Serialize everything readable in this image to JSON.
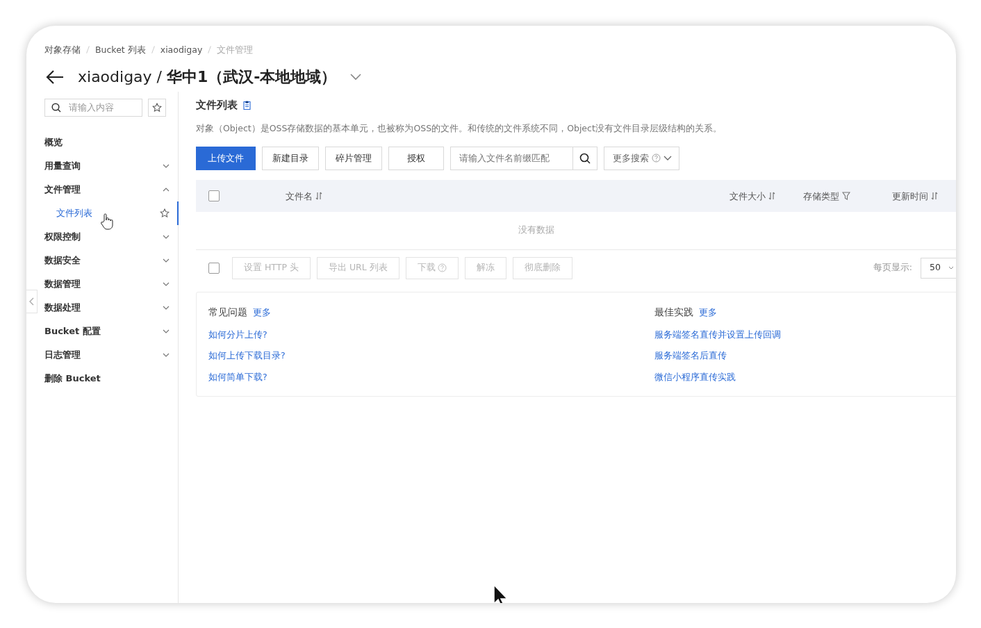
{
  "breadcrumb": [
    {
      "label": "对象存储",
      "current": false
    },
    {
      "label": "Bucket 列表",
      "current": false
    },
    {
      "label": "xiaodigay",
      "current": false
    },
    {
      "label": "文件管理",
      "current": true
    }
  ],
  "title": "xiaodigay / 华中1（武汉-本地地域）",
  "sidebar": {
    "search": {
      "placeholder": "请输入内容"
    },
    "items": [
      {
        "label": "概览",
        "kind": "link"
      },
      {
        "label": "用量查询",
        "kind": "group",
        "expanded": false
      },
      {
        "label": "文件管理",
        "kind": "group",
        "expanded": true,
        "children": [
          {
            "label": "文件列表",
            "selected": true
          }
        ]
      },
      {
        "label": "权限控制",
        "kind": "group",
        "expanded": false
      },
      {
        "label": "数据安全",
        "kind": "group",
        "expanded": false
      },
      {
        "label": "数据管理",
        "kind": "group",
        "expanded": false
      },
      {
        "label": "数据处理",
        "kind": "group",
        "expanded": false
      },
      {
        "label": "Bucket 配置",
        "kind": "group",
        "expanded": false
      },
      {
        "label": "日志管理",
        "kind": "group",
        "expanded": false
      },
      {
        "label": "删除 Bucket",
        "kind": "link"
      }
    ]
  },
  "main": {
    "heading": "文件列表",
    "description": "对象（Object）是OSS存储数据的基本单元，也被称为OSS的文件。和传统的文件系统不同，Object没有文件目录层级结构的关系。",
    "toolbar": [
      {
        "label": "上传文件",
        "kind": "primary"
      },
      {
        "label": "新建目录",
        "kind": "default"
      },
      {
        "label": "碎片管理",
        "kind": "default"
      },
      {
        "label": "授权",
        "kind": "default"
      }
    ],
    "search": {
      "placeholder": "请输入文件名前缀匹配"
    },
    "more_search": "更多搜索",
    "table": {
      "select_all": {
        "checked": false
      },
      "columns": [
        {
          "label": "文件名",
          "kind": "sort"
        },
        {
          "label": "文件大小",
          "kind": "sort"
        },
        {
          "label": "存储类型",
          "kind": "filter"
        },
        {
          "label": "更新时间",
          "kind": "sort"
        }
      ],
      "empty_text": "没有数据"
    },
    "bulk": {
      "select_all": {
        "checked": false
      },
      "buttons": [
        {
          "label": "设置 HTTP 头",
          "disabled": true,
          "help": false
        },
        {
          "label": "导出 URL 列表",
          "disabled": true,
          "help": false
        },
        {
          "label": "下载",
          "disabled": true,
          "help": true
        },
        {
          "label": "解冻",
          "disabled": true,
          "help": false
        },
        {
          "label": "彻底删除",
          "disabled": true,
          "help": false
        }
      ],
      "page_size_label": "每页显示:",
      "page_size": "50"
    },
    "help": [
      {
        "title": "常见问题",
        "more": "更多",
        "links": [
          "如何分片上传?",
          "如何上传下载目录?",
          "如何简单下载?"
        ]
      },
      {
        "title": "最佳实践",
        "more": "更多",
        "links": [
          "服务端签名直传并设置上传回调",
          "服务端签名后直传",
          "微信小程序直传实践"
        ]
      }
    ]
  }
}
